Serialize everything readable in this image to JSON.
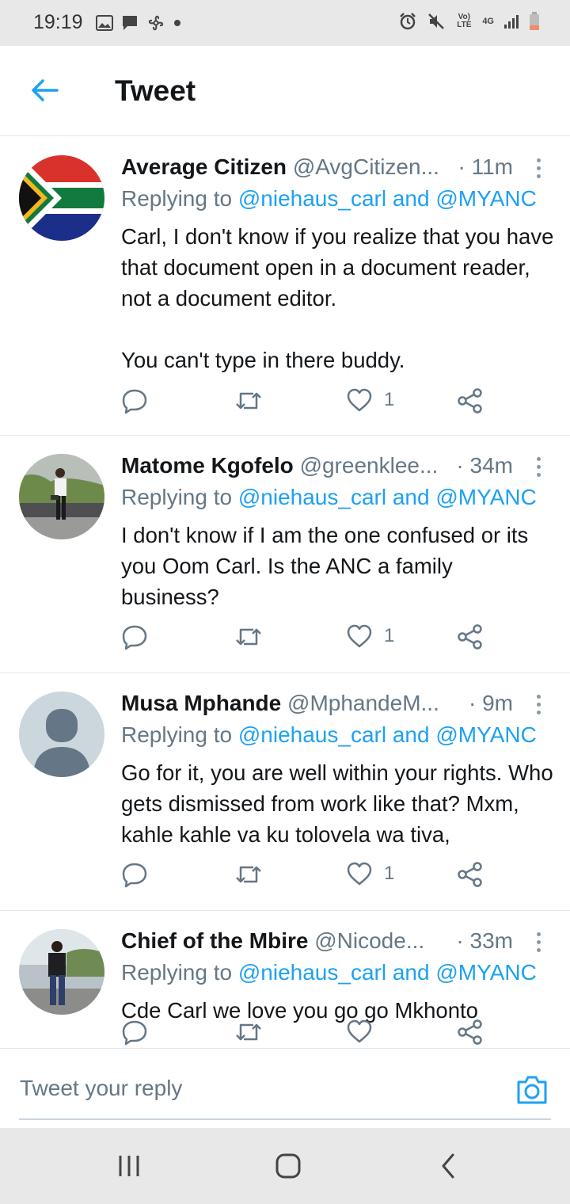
{
  "status_bar": {
    "time": "19:19",
    "left_icons": [
      "image-icon",
      "message-icon",
      "fan-icon",
      "dot-icon"
    ],
    "right_icons": [
      "alarm-icon",
      "mute-icon",
      "volte-icon",
      "4g-icon",
      "signal-icon",
      "battery-icon"
    ],
    "volte_label": "Vo) LTE",
    "network_label": "4G"
  },
  "header": {
    "back_icon": "arrow-left-icon",
    "title": "Tweet"
  },
  "tweets": [
    {
      "display_name": "Average Citizen",
      "handle": "@AvgCitizen...",
      "time": "· 11m",
      "reply_prefix": "Replying to ",
      "mentions": "@niehaus_carl and @MYANC",
      "text": "Carl, I don't know if you realize that you have that document open in a document reader, not a document editor.\n\nYou can't type in there buddy.",
      "likes": "1",
      "avatar": "south-africa-flag"
    },
    {
      "display_name": "Matome Kgofelo",
      "handle": "@greenklee...",
      "time": "· 34m",
      "reply_prefix": "Replying to ",
      "mentions": "@niehaus_carl and @MYANC",
      "text": "I don't know if I am the one confused or its you Oom Carl. Is the ANC a family business?",
      "likes": "1",
      "avatar": "person-photo"
    },
    {
      "display_name": "Musa Mphande",
      "handle": "@MphandeM...",
      "time": "· 9m",
      "reply_prefix": "Replying to ",
      "mentions": "@niehaus_carl and @MYANC",
      "text": "Go for it, you are well within your rights. Who gets dismissed from work like that? Mxm, kahle kahle va ku tolovela wa tiva,",
      "likes": "1",
      "avatar": "default-avatar"
    },
    {
      "display_name": "Chief of the Mbire",
      "handle": "@Nicode...",
      "time": "· 33m",
      "reply_prefix": "Replying to ",
      "mentions": "@niehaus_carl and @MYANC",
      "text": "Cde Carl we love you go go Mkhonto",
      "likes": "",
      "avatar": "person-photo"
    }
  ],
  "reply_bar": {
    "placeholder": "Tweet your reply",
    "camera_icon": "camera-icon"
  },
  "nav_bar": {
    "icons": [
      "recent-apps-icon",
      "home-icon",
      "back-icon"
    ]
  },
  "colors": {
    "accent": "#1da1f2",
    "text_primary": "#14171a",
    "text_secondary": "#657786",
    "divider": "#e1e8ed"
  }
}
